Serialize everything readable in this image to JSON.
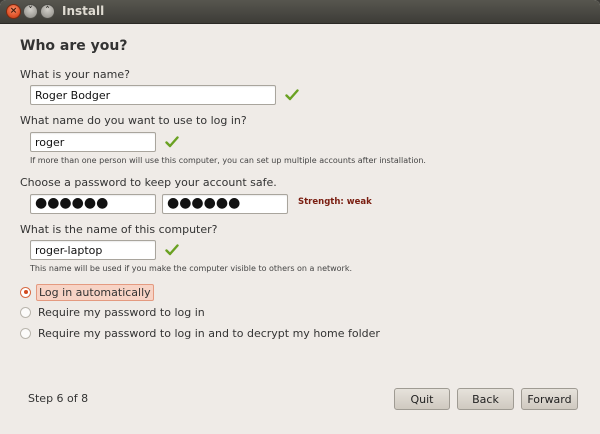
{
  "window": {
    "title": "Install"
  },
  "page": {
    "heading": "Who are you?"
  },
  "name_question": {
    "label": "What is your name?",
    "value": "Roger Bodger"
  },
  "login_question": {
    "label": "What name do you want to use to log in?",
    "value": "roger",
    "hint": "If more than one person will use this computer, you can set up multiple accounts after installation."
  },
  "password_question": {
    "label": "Choose a password to keep your account safe.",
    "password_mask": "●●●●●●",
    "confirm_mask": "●●●●●●",
    "strength": "Strength: weak"
  },
  "computer_question": {
    "label": "What is the name of this computer?",
    "value": "roger-laptop",
    "hint": "This name will be used if you make the computer visible to others on a network."
  },
  "login_options": {
    "selected": "Log in automatically",
    "items": [
      "Log in automatically",
      "Require my password to log in",
      "Require my password to log in and to decrypt my home folder"
    ]
  },
  "footer": {
    "step": "Step 6 of 8",
    "quit": "Quit",
    "back": "Back",
    "forward": "Forward"
  },
  "colors": {
    "accent": "#d24a1e",
    "check": "#6aa122",
    "strength": "#7a1e11"
  }
}
